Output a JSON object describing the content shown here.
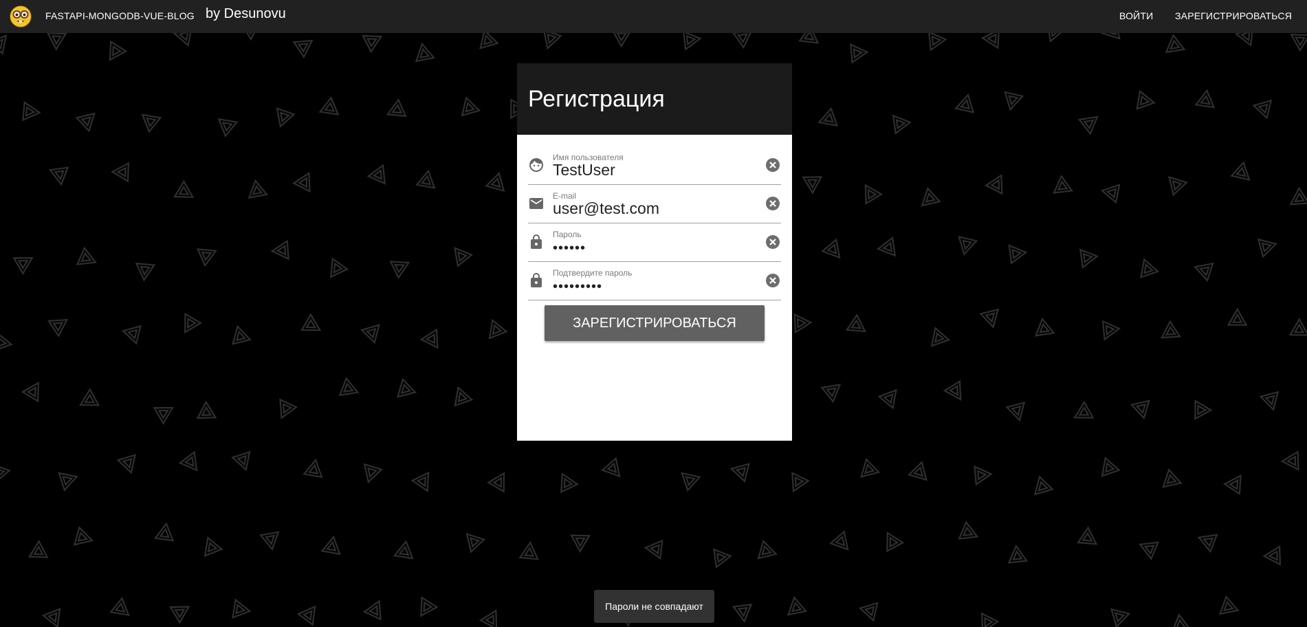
{
  "appbar": {
    "logo_icon": "nerd-face-emoji",
    "title": "FASTAPI-MONGODB-VUE-BLOG",
    "author": "by Desunovu",
    "nav": {
      "login_label": "ВОЙТИ",
      "register_label": "ЗАРЕГИСТРИРОВАТЬСЯ"
    }
  },
  "form": {
    "title": "Регистрация",
    "fields": [
      {
        "icon": "face-icon",
        "label": "Имя пользователя",
        "value": "TestUser"
      },
      {
        "icon": "email-icon",
        "label": "E-mail",
        "value": "user@test.com"
      },
      {
        "icon": "lock-icon",
        "label": "Пароль",
        "value": "••••••"
      },
      {
        "icon": "lock-icon",
        "label": "Подтвердите пароль",
        "value": "•••••••••"
      }
    ],
    "submit_label": "ЗАРЕГИСТРИРОВАТЬСЯ"
  },
  "snackbar": {
    "message": "Пароли не совпадают"
  },
  "colors": {
    "appbar_bg": "#212121",
    "card_header_bg": "#1b1b1b",
    "button_bg": "#616161",
    "snackbar_bg": "#323232",
    "page_bg": "#000000"
  }
}
